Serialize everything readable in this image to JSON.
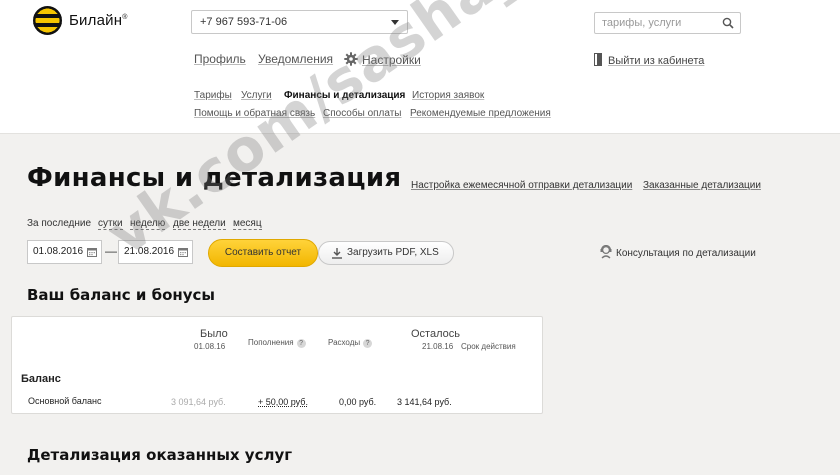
{
  "header": {
    "logo_text": "Билайн",
    "logo_mark": "®",
    "phone": "+7 967 593-71-06",
    "search_placeholder": "тарифы, услуги",
    "nav": {
      "profile": "Профиль",
      "notifications": "Уведомления",
      "settings": "Настройки"
    },
    "logout": "Выйти из кабинета",
    "subnav": {
      "tariffs": "Тарифы",
      "services": "Услуги",
      "finance": "Финансы и детализация",
      "history": "История заявок",
      "help": "Помощь и обратная связь",
      "payment": "Способы оплаты",
      "recommended": "Рекомендуемые предложения"
    }
  },
  "page": {
    "title": "Финансы и детализация",
    "link_monthly": "Настройка ежемесячной отправки детализации",
    "link_ordered": "Заказанные детализации"
  },
  "period": {
    "label": "За последние",
    "options": [
      "сутки",
      "неделю",
      "две недели",
      "месяц"
    ],
    "date_from": "01.08.2016",
    "date_sep": "—",
    "date_to": "21.08.2016",
    "report_button": "Составить отчет",
    "download_button": "Загрузить PDF, XLS",
    "consult": "Консультация по детализации"
  },
  "balance": {
    "title": "Ваш баланс и бонусы",
    "headers": {
      "was": "Было",
      "was_date": "01.08.16",
      "topups": "Пополнения",
      "expenses": "Расходы",
      "left": "Осталось",
      "left_date": "21.08.16",
      "validity": "Срок действия"
    },
    "group": "Баланс",
    "rows": [
      {
        "name": "Основной баланс",
        "was": "3 091,64 руб.",
        "topups": "+ 50,00 руб.",
        "expenses": "0,00 руб.",
        "left": "3 141,64 руб."
      }
    ]
  },
  "details": {
    "title": "Детализация оказанных услуг"
  },
  "watermark": "vk.com/sasha_kanev"
}
